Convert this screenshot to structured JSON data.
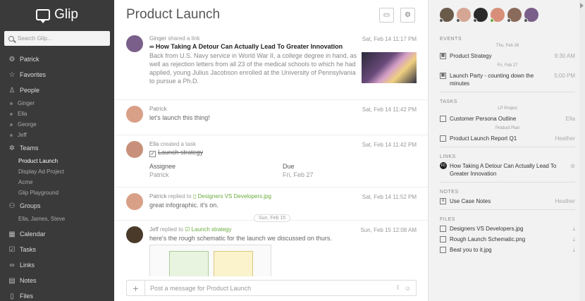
{
  "app": {
    "name": "Glip"
  },
  "sidebar": {
    "search_placeholder": "Search Glip...",
    "items": [
      {
        "label": "Patrick",
        "icon": "gear-icon"
      },
      {
        "label": "Favorites",
        "icon": "star-icon"
      },
      {
        "label": "People",
        "icon": "person-icon"
      }
    ],
    "people": [
      "Ginger",
      "Ella",
      "George",
      "Jeff"
    ],
    "teams_label": "Teams",
    "teams": [
      "Product Launch",
      "Display Ad Project",
      "Acme",
      "Glip Playground"
    ],
    "groups_label": "Groups",
    "groups": [
      "Ella, James, Steve"
    ],
    "bottom": [
      {
        "label": "Calendar",
        "icon": "calendar-icon"
      },
      {
        "label": "Tasks",
        "icon": "checkbox-icon"
      },
      {
        "label": "Links",
        "icon": "link-icon"
      },
      {
        "label": "Notes",
        "icon": "note-icon"
      },
      {
        "label": "Files",
        "icon": "file-icon"
      }
    ]
  },
  "main": {
    "title": "Product Launch",
    "posts": [
      {
        "author": "Ginger",
        "action": "shared a link",
        "time": "Sat, Feb 14 11:17 PM",
        "link_title": "How Taking A Detour Can Actually Lead To Greater Innovation",
        "link_desc": "Back from U.S. Navy service in World War II, a college degree in hand, as well as rejection letters from all 23 of the medical schools to which he had applied, young Julius Jacobson enrolled at the University of Pennsylvania to pursue a Ph.D."
      },
      {
        "author": "Patrick",
        "time": "Sat, Feb 14 11:42 PM",
        "text": "let's launch this thing!"
      },
      {
        "author": "Ella",
        "action": "created a task",
        "time": "Sat, Feb 14 11:42 PM",
        "task": "Launch strategy",
        "assignee_label": "Assignee",
        "assignee": "Patrick",
        "due_label": "Due",
        "due": "Fri, Feb 27"
      },
      {
        "author": "Patrick",
        "action": "replied to",
        "target": "Designers VS Developers.jpg",
        "time": "Sat, Feb 14 11:52 PM",
        "text": "great infographic. it's on."
      },
      {
        "author": "Jeff",
        "action": "replied to",
        "target": "Launch strategy",
        "time": "Sun, Feb 15 12:08 AM",
        "text": "here's the rough schematic for the launch we discussed on thurs."
      }
    ],
    "date_divider": "Sun, Feb 15",
    "composer_placeholder": "Post a message for Product Launch"
  },
  "right": {
    "events_label": "EVENTS",
    "events": [
      {
        "date": "Thu, Feb 26",
        "title": "Product Strategy",
        "time": "9:30 AM"
      },
      {
        "date": "Fri, Feb 27",
        "title": "Launch Party - counting down the minutes",
        "time": "5:00 PM"
      }
    ],
    "tasks_label": "TASKS",
    "tasks": [
      {
        "group": "LP Project",
        "title": "Customer Persona Outline",
        "who": "Ella"
      },
      {
        "group": "Product Plan",
        "title": "Product Launch Report Q1",
        "who": "Heather"
      }
    ],
    "links_label": "LINKS",
    "links": [
      {
        "title": "How Taking A Detour Can Actually Lead To Greater Innovation"
      }
    ],
    "notes_label": "NOTES",
    "notes": [
      {
        "title": "Use Case Notes",
        "who": "Heather"
      }
    ],
    "files_label": "FILES",
    "files": [
      {
        "title": "Designers VS Developers.jpg"
      },
      {
        "title": "Rough Launch Schematic.png"
      },
      {
        "title": "Beat you to it.jpg"
      }
    ]
  },
  "colors": {
    "sidebar_bg": "#3a3a3a",
    "accent_green": "#6aab3e",
    "panel_bg": "#f2f2f2"
  }
}
